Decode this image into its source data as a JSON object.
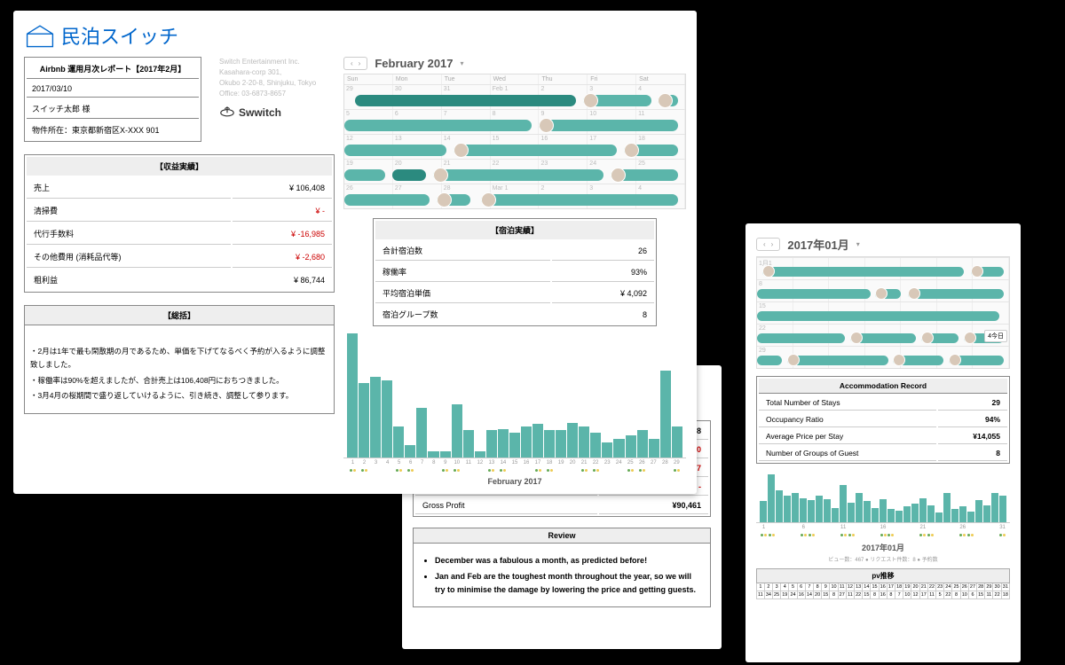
{
  "panel1": {
    "logo_text": "民泊スイッチ",
    "info": {
      "title": "Airbnb 運用月次レポート【2017年2月】",
      "date": "2017/03/10",
      "customer": "スイッチ太郎 様",
      "address": "物件所在：東京都新宿区X-XXX  901"
    },
    "company": {
      "name": "Switch Entertainment Inc.",
      "line2": "Kasahara-corp 301,",
      "line3": "Okubo 2-20-8, Shinjuku, Tokyo",
      "line4": "Office: 03-6873-8657",
      "brand": "Swwitch"
    },
    "revenue": {
      "header": "【収益実績】",
      "rows": [
        {
          "label": "売上",
          "value": "¥ 106,408"
        },
        {
          "label": "清掃費",
          "value": "¥ -",
          "neg": true
        },
        {
          "label": "代行手数料",
          "value": "¥ -16,985",
          "neg": true
        },
        {
          "label": "その他費用 (消耗品代等)",
          "value": "¥ -2,680",
          "neg": true
        },
        {
          "label": "粗利益",
          "value": "¥ 86,744"
        }
      ]
    },
    "summary": {
      "header": "【総括】",
      "bullets": [
        "・2月は1年で最も閑散期の月であるため、単価を下げてなるべく予約が入るように調整致しました。",
        "・稼働率は90%を超えましたが、合計売上は106,408円におちつきました。",
        "・3月4月の桜期間で盛り返していけるように、引き続き、調整して参ります。"
      ]
    },
    "calendar": {
      "title": "February 2017",
      "days": [
        "Sun",
        "Mon",
        "Tue",
        "Wed",
        "Thu",
        "Fri",
        "Sat"
      ],
      "weeks": [
        {
          "start": "29",
          "cells": [
            "29",
            "30",
            "31",
            "Feb 1",
            "2",
            "3",
            "4"
          ]
        },
        {
          "start": "5",
          "cells": [
            "5",
            "6",
            "7",
            "8",
            "9",
            "10",
            "11"
          ]
        },
        {
          "start": "12",
          "cells": [
            "12",
            "13",
            "14",
            "15",
            "16",
            "17",
            "18"
          ]
        },
        {
          "start": "19",
          "cells": [
            "19",
            "20",
            "21",
            "22",
            "23",
            "24",
            "25"
          ]
        },
        {
          "start": "26",
          "cells": [
            "26",
            "27",
            "28",
            "Mar 1",
            "2",
            "3",
            "4"
          ]
        }
      ]
    },
    "stay": {
      "header": "【宿泊実績】",
      "rows": [
        {
          "label": "合計宿泊数",
          "value": "26"
        },
        {
          "label": "稼働率",
          "value": "93%"
        },
        {
          "label": "平均宿泊単価",
          "value": "¥ 4,092"
        },
        {
          "label": "宿泊グループ数",
          "value": "8"
        }
      ]
    },
    "chart_title": "February 2017"
  },
  "panel2": {
    "fin_rows": [
      {
        "label": "",
        "value": "115,068"
      },
      {
        "label": "",
        "value": "-¥5,500",
        "neg": true
      },
      {
        "label": "",
        "value": "¥19,107",
        "neg": true
      },
      {
        "label": "Other Expenses",
        "value": "¥ -",
        "neg": true
      },
      {
        "label": "Gross Profit",
        "value": "¥90,461"
      }
    ],
    "review_header": "Review",
    "review_items": [
      "December was a fabulous a month, as predicted before!",
      "Jan and Feb are the toughest month throughout the year, so we will try to minimise the damage by lowering the price and getting guests."
    ]
  },
  "panel3": {
    "cal_title": "2017年01月",
    "cal_days": [
      "1月1",
      "",
      "",
      "",
      "",
      "",
      ""
    ],
    "week_starts": [
      "1月1",
      "8",
      "15",
      "22",
      "29"
    ],
    "badge": "4今日",
    "acc": {
      "header": "Accommodation Record",
      "rows": [
        {
          "label": "Total Number of Stays",
          "value": "29"
        },
        {
          "label": "Occupancy Ratio",
          "value": "94%"
        },
        {
          "label": "Average Price per Stay",
          "value": "¥14,055"
        },
        {
          "label": "Number of Groups of Guest",
          "value": "8"
        }
      ]
    },
    "mini_chart_title": "2017年01月",
    "mini_stats": "ビュー数：467 ● リクエスト件数：8 ● 予約数",
    "pv": {
      "header": "pv推移",
      "days": [
        "1",
        "2",
        "3",
        "4",
        "5",
        "6",
        "7",
        "8",
        "9",
        "10",
        "11",
        "12",
        "13",
        "14",
        "15",
        "16",
        "17",
        "18",
        "19",
        "20",
        "21",
        "22",
        "23",
        "24",
        "25",
        "26",
        "27",
        "28",
        "29",
        "30",
        "31"
      ],
      "values": [
        "11",
        "34",
        "25",
        "19",
        "24",
        "16",
        "14",
        "20",
        "15",
        "8",
        "27",
        "11",
        "22",
        "15",
        "8",
        "16",
        "8",
        "7",
        "10",
        "12",
        "17",
        "11",
        "5",
        "22",
        "8",
        "10",
        "6",
        "15",
        "11",
        "22",
        "18"
      ]
    }
  },
  "chart_data": [
    {
      "type": "bar",
      "title": "February 2017",
      "categories": [
        "1",
        "2",
        "3",
        "4",
        "5",
        "6",
        "7",
        "8",
        "9",
        "10",
        "11",
        "12",
        "13",
        "14",
        "15",
        "16",
        "17",
        "18",
        "19",
        "20",
        "21",
        "22",
        "23",
        "24",
        "25",
        "26",
        "27",
        "28",
        "29"
      ],
      "values": [
        100,
        60,
        65,
        62,
        25,
        10,
        40,
        5,
        5,
        43,
        22,
        5,
        22,
        23,
        20,
        25,
        27,
        22,
        22,
        28,
        25,
        20,
        12,
        15,
        18,
        22,
        15,
        70,
        25
      ],
      "ylim": [
        0,
        100
      ]
    },
    {
      "type": "bar",
      "title": "2017年01月",
      "categories": [
        "1",
        "2",
        "3",
        "4",
        "5",
        "6",
        "7",
        "8",
        "9",
        "10",
        "11",
        "12",
        "13",
        "14",
        "15",
        "16",
        "17",
        "18",
        "19",
        "20",
        "21",
        "22",
        "23",
        "24",
        "25",
        "26",
        "27",
        "28",
        "29",
        "30",
        "31"
      ],
      "values": [
        40,
        90,
        60,
        50,
        55,
        45,
        42,
        50,
        43,
        26,
        70,
        36,
        55,
        40,
        26,
        43,
        25,
        22,
        30,
        35,
        45,
        32,
        18,
        55,
        25,
        30,
        20,
        42,
        32,
        55,
        50
      ],
      "ylim": [
        0,
        100
      ]
    }
  ]
}
